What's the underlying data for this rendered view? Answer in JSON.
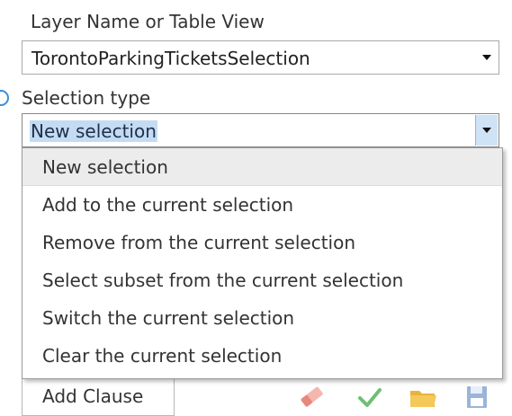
{
  "layer": {
    "label": "Layer Name or Table View",
    "value": "TorontoParkingTicketsSelection"
  },
  "selection_type": {
    "label": "Selection type",
    "value": "New selection",
    "options": [
      "New selection",
      "Add to the current selection",
      "Remove from the current selection",
      "Select subset from the current selection",
      "Switch the current selection",
      "Clear the current selection"
    ]
  },
  "toolbar": {
    "add_clause_label": "Add Clause",
    "icons": [
      "eraser-icon",
      "check-icon",
      "folder-icon",
      "save-icon"
    ]
  },
  "colors": {
    "selected_highlight": "#c4dcf3",
    "hover_row": "#ececec",
    "check_green": "#6fbf73",
    "folder_yellow": "#f2c14e",
    "save_blue": "#9bb4d8"
  }
}
